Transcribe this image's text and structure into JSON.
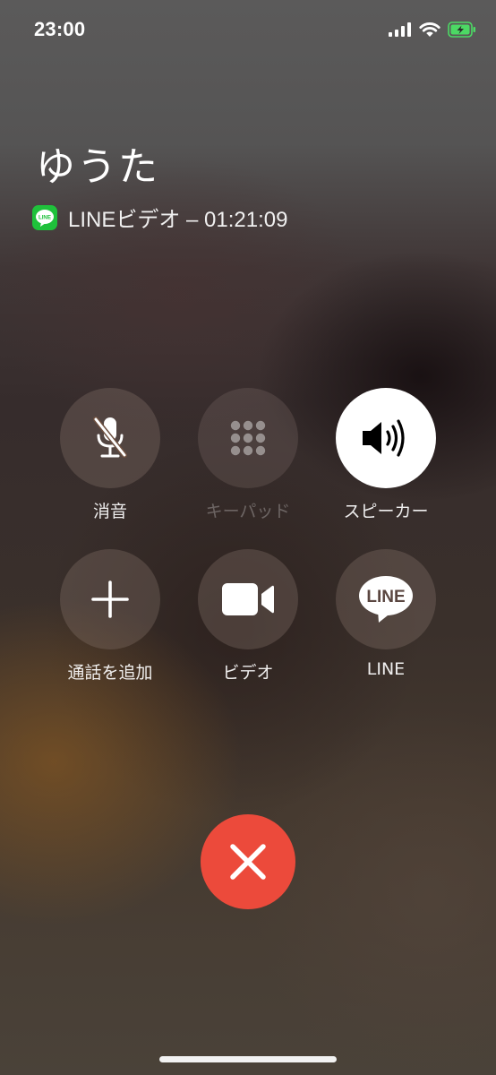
{
  "status_bar": {
    "time": "23:00",
    "signal_icon": "cellular-signal-icon",
    "wifi_icon": "wifi-icon",
    "battery_icon": "battery-charging-icon",
    "battery_color": "#4cd964"
  },
  "call": {
    "caller_name": "ゆうた",
    "app_badge": "LINE",
    "status_text": "LINEビデオ – 01:21:09",
    "badge_color": "#1fc13b"
  },
  "controls": {
    "mute": {
      "label": "消音",
      "icon": "microphone-muted-icon"
    },
    "keypad": {
      "label": "キーパッド",
      "icon": "keypad-icon",
      "enabled": false
    },
    "speaker": {
      "label": "スピーカー",
      "icon": "speaker-icon",
      "active": true
    },
    "add_call": {
      "label": "通話を追加",
      "icon": "plus-icon"
    },
    "video": {
      "label": "ビデオ",
      "icon": "video-camera-icon"
    },
    "line": {
      "label": "LINE",
      "icon": "line-bubble-icon",
      "bubble_text": "LINE"
    }
  },
  "end_call": {
    "icon": "close-icon",
    "color": "#ec4a3b"
  }
}
